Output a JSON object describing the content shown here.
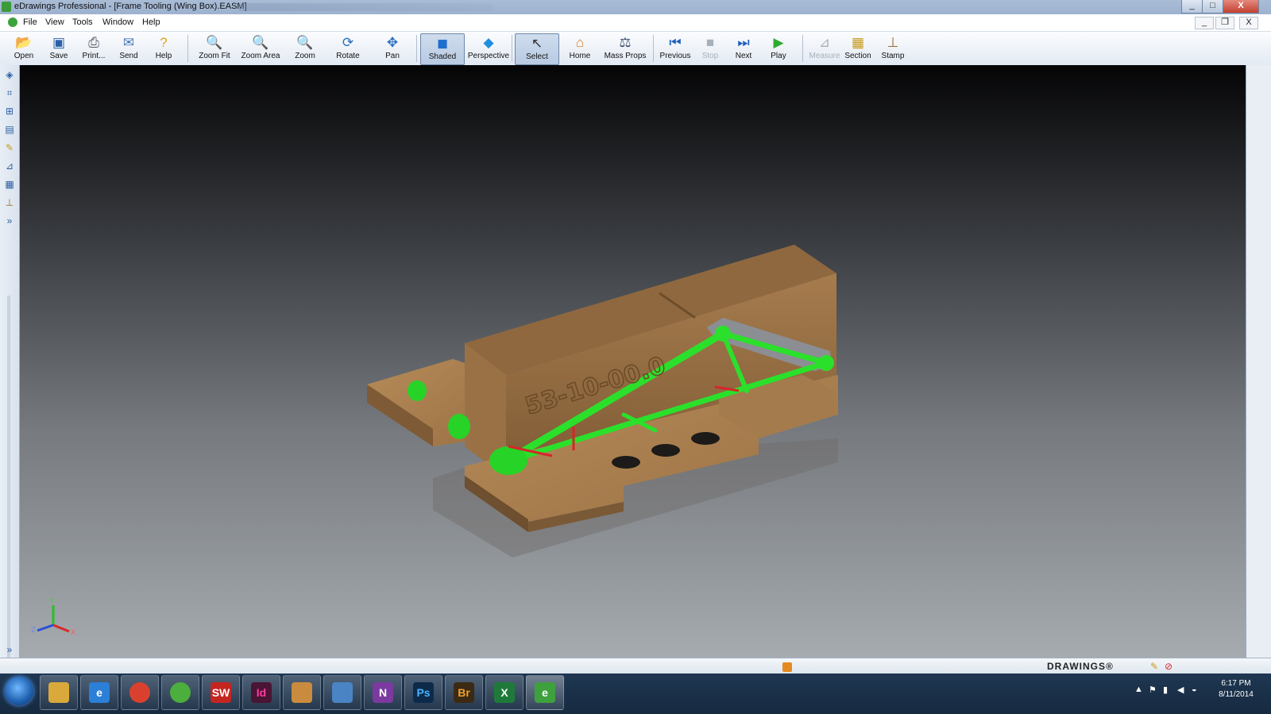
{
  "window": {
    "title": "eDrawings Professional - [Frame Tooling (Wing Box).EASM]",
    "controls": [
      "_",
      "□",
      "X"
    ]
  },
  "menu": {
    "items": [
      "File",
      "View",
      "Tools",
      "Window",
      "Help"
    ],
    "mdi_controls": [
      "_",
      "❐",
      "X"
    ]
  },
  "toolbar": {
    "buttons": [
      {
        "label": "Open",
        "icon": "open-folder-icon"
      },
      {
        "label": "Save",
        "icon": "save-disk-icon"
      },
      {
        "label": "Print...",
        "icon": "printer-icon"
      },
      {
        "label": "Send",
        "icon": "send-mail-icon"
      },
      {
        "label": "Help",
        "icon": "help-icon"
      },
      {
        "label": "Zoom Fit",
        "icon": "zoom-fit-icon"
      },
      {
        "label": "Zoom Area",
        "icon": "zoom-area-icon"
      },
      {
        "label": "Zoom",
        "icon": "zoom-icon"
      },
      {
        "label": "Rotate",
        "icon": "rotate-icon"
      },
      {
        "label": "Pan",
        "icon": "pan-icon"
      },
      {
        "label": "Shaded",
        "icon": "shaded-cube-icon",
        "active": true
      },
      {
        "label": "Perspective",
        "icon": "perspective-icon"
      },
      {
        "label": "Select",
        "icon": "select-cursor-icon",
        "active": true
      },
      {
        "label": "Home",
        "icon": "home-icon"
      },
      {
        "label": "Mass Props",
        "icon": "mass-props-icon"
      },
      {
        "label": "Previous",
        "icon": "previous-icon"
      },
      {
        "label": "Stop",
        "icon": "stop-icon",
        "disabled": true
      },
      {
        "label": "Next",
        "icon": "next-icon"
      },
      {
        "label": "Play",
        "icon": "play-icon"
      },
      {
        "label": "Measure",
        "icon": "measure-icon",
        "disabled": true
      },
      {
        "label": "Section",
        "icon": "section-icon"
      },
      {
        "label": "Stamp",
        "icon": "stamp-icon"
      }
    ]
  },
  "model": {
    "part_number": "53-10-00.0",
    "colors": {
      "wood": "#a47b4d",
      "tube": "#2be02b",
      "plate": "#8b8e93",
      "accent": "#d8252a"
    }
  },
  "triad": {
    "labels": [
      "Y",
      "Z",
      "X"
    ]
  },
  "status": {
    "brand": "DRAWINGS®"
  },
  "taskbar": {
    "apps": [
      {
        "name": "file-explorer",
        "text": "",
        "color": "#d9a93b"
      },
      {
        "name": "internet-explorer",
        "text": "e",
        "color": "#2b7fd6"
      },
      {
        "name": "chrome",
        "text": "",
        "color": "#d9412e"
      },
      {
        "name": "app-green",
        "text": "",
        "color": "#4cae3c"
      },
      {
        "name": "solidworks",
        "text": "SW",
        "color": "#c52520"
      },
      {
        "name": "indesign",
        "text": "Id",
        "color": "#4a1434"
      },
      {
        "name": "folder-app",
        "text": "",
        "color": "#c98b3e"
      },
      {
        "name": "remote-desktop",
        "text": "",
        "color": "#4a84c4"
      },
      {
        "name": "onenote",
        "text": "N",
        "color": "#7b3aa0"
      },
      {
        "name": "photoshop",
        "text": "Ps",
        "color": "#0d2a4a"
      },
      {
        "name": "bridge",
        "text": "Br",
        "color": "#3b2a14"
      },
      {
        "name": "excel",
        "text": "X",
        "color": "#1f7a3a"
      },
      {
        "name": "edrawings",
        "text": "e",
        "color": "#3ea13e"
      }
    ],
    "clock_time": "6:17 PM",
    "clock_date": "8/11/2014"
  }
}
